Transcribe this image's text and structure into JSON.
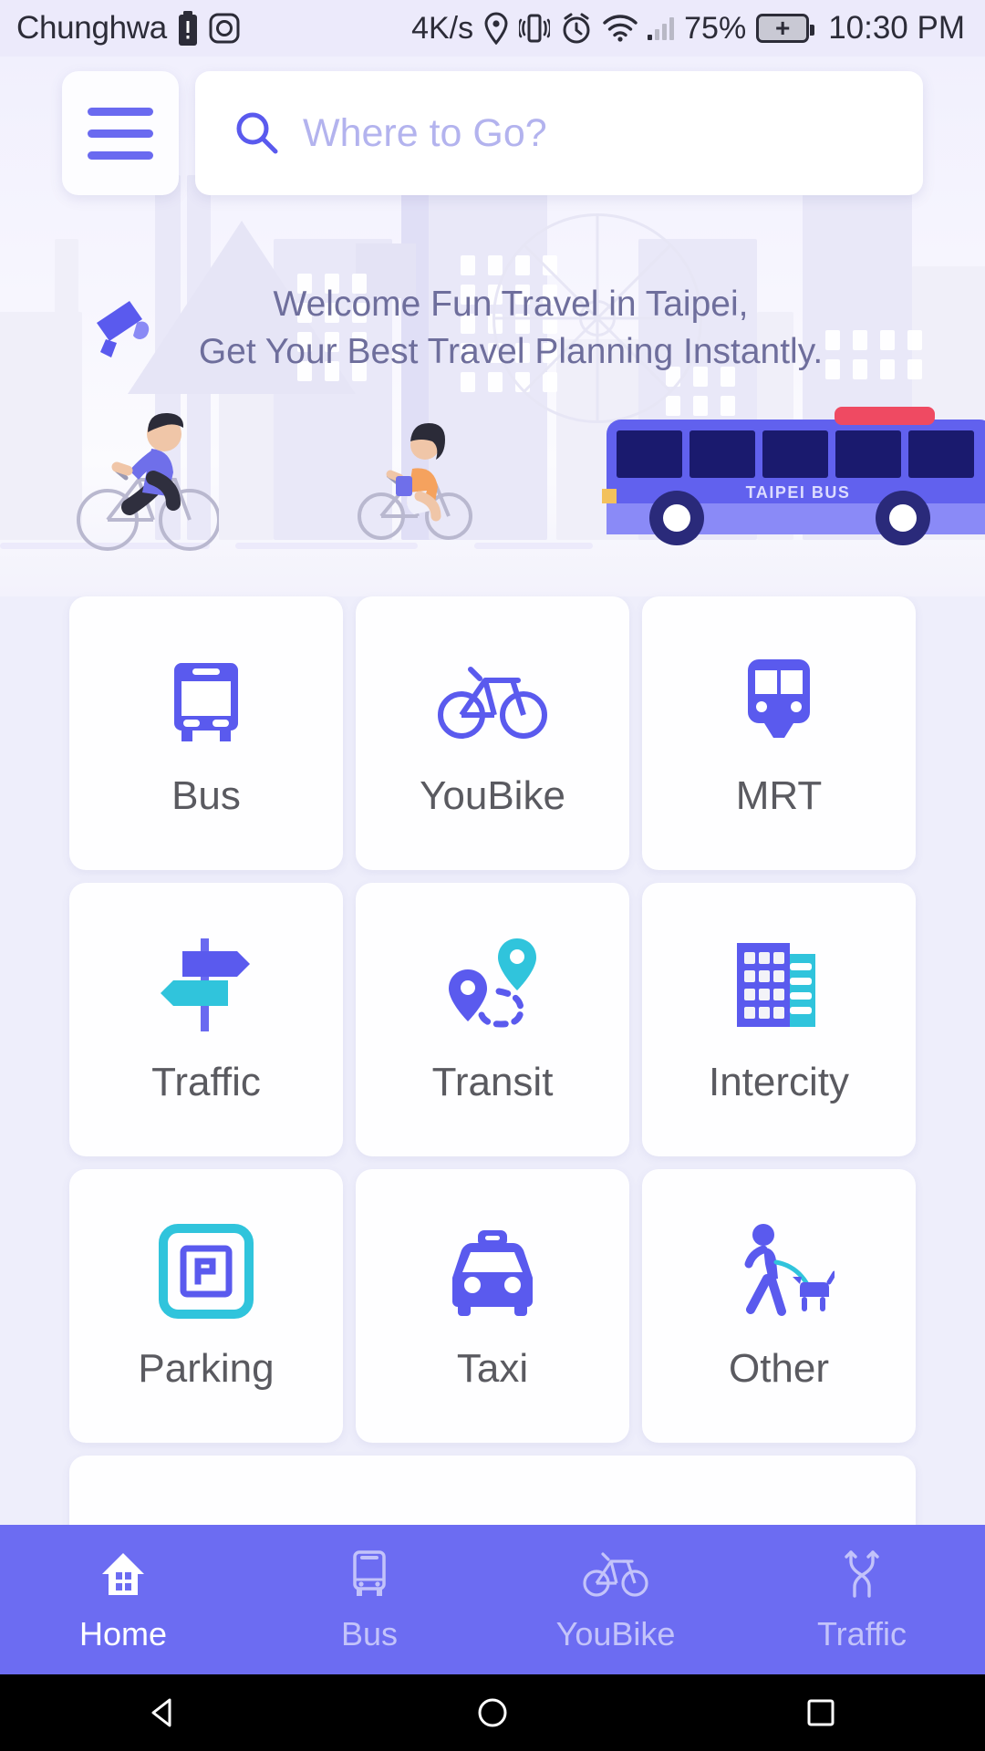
{
  "status_bar": {
    "carrier": "Chunghwa",
    "data_rate": "4K/s",
    "battery_percent": "75%",
    "time": "10:30 PM",
    "icons": [
      "battery-alert-icon",
      "camera-icon",
      "location-pin-icon",
      "vibrate-icon",
      "alarm-icon",
      "wifi-icon",
      "signal-bars-icon",
      "battery-charging-icon"
    ]
  },
  "topbar": {
    "menu_icon": "hamburger-menu-icon",
    "search_icon": "search-icon",
    "search_placeholder": "Where to Go?",
    "search_value": ""
  },
  "hero": {
    "welcome_line1": "Welcome Fun Travel in Taipei,",
    "welcome_line2": "Get Your Best Travel Planning Instantly.",
    "megaphone_icon": "megaphone-icon",
    "bus_label": "TAIPEI BUS"
  },
  "grid": {
    "tiles": [
      {
        "label": "Bus",
        "icon": "bus-front-icon"
      },
      {
        "label": "YouBike",
        "icon": "bicycle-icon"
      },
      {
        "label": "MRT",
        "icon": "metro-train-icon"
      },
      {
        "label": "Traffic",
        "icon": "signpost-icon"
      },
      {
        "label": "Transit",
        "icon": "route-pins-icon"
      },
      {
        "label": "Intercity",
        "icon": "city-buildings-icon"
      },
      {
        "label": "Parking",
        "icon": "parking-sign-icon"
      },
      {
        "label": "Taxi",
        "icon": "taxi-front-icon"
      },
      {
        "label": "Other",
        "icon": "person-walking-dog-icon"
      }
    ]
  },
  "bottom_nav": {
    "items": [
      {
        "label": "Home",
        "icon": "home-icon",
        "active": true
      },
      {
        "label": "Bus",
        "icon": "bus-icon",
        "active": false
      },
      {
        "label": "YouBike",
        "icon": "bicycle-icon",
        "active": false
      },
      {
        "label": "Traffic",
        "icon": "traffic-routes-icon",
        "active": false
      }
    ]
  },
  "system_nav": {
    "back": "back-triangle-icon",
    "home": "home-circle-icon",
    "recents": "recents-square-icon"
  },
  "colors": {
    "accent_purple": "#6a6af0",
    "accent_cyan": "#35c6dd",
    "nav_bar": "#6c6cf2",
    "page_bg": "#eeeefb",
    "tile_bg": "#fefeff",
    "label_gray": "#5a5a60",
    "placeholder": "#b3b3ee"
  }
}
